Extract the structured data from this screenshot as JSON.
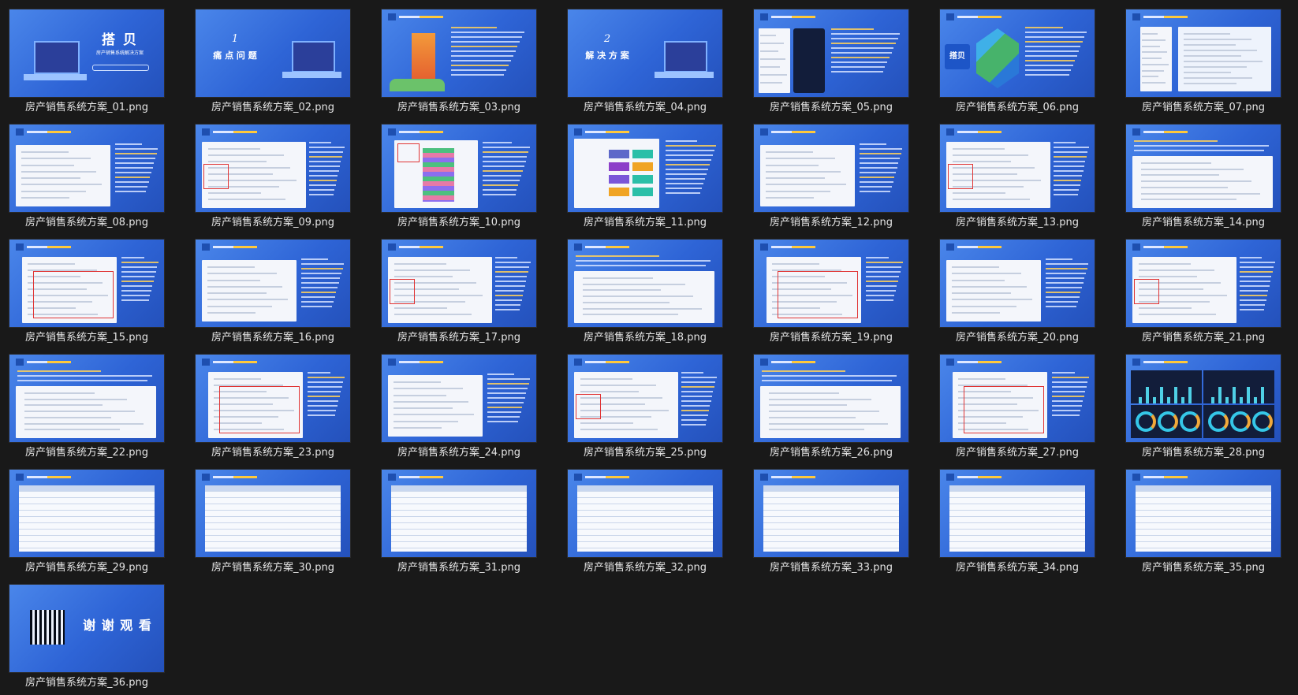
{
  "files": [
    {
      "name": "房产销售系统方案_01.png",
      "kind": "cover",
      "title": "搭 贝",
      "subtitle": "房产销售系统解决方案"
    },
    {
      "name": "房产销售系统方案_02.png",
      "kind": "section",
      "num": "1",
      "title": "痛 点 问 题"
    },
    {
      "name": "房产销售系统方案_03.png",
      "kind": "illus"
    },
    {
      "name": "房产销售系统方案_04.png",
      "kind": "section",
      "num": "2",
      "title": "解 决 方 案"
    },
    {
      "name": "房产销售系统方案_05.png",
      "kind": "phones"
    },
    {
      "name": "房产销售系统方案_06.png",
      "kind": "logo",
      "logo": "搭贝"
    },
    {
      "name": "房产销售系统方案_07.png",
      "kind": "arch"
    },
    {
      "name": "房产销售系统方案_08.png",
      "kind": "screen"
    },
    {
      "name": "房产销售系统方案_09.png",
      "kind": "screen"
    },
    {
      "name": "房产销售系统方案_10.png",
      "kind": "floor"
    },
    {
      "name": "房产销售系统方案_11.png",
      "kind": "floorgrid"
    },
    {
      "name": "房产销售系统方案_12.png",
      "kind": "screen"
    },
    {
      "name": "房产销售系统方案_13.png",
      "kind": "screen"
    },
    {
      "name": "房产销售系统方案_14.png",
      "kind": "screen"
    },
    {
      "name": "房产销售系统方案_15.png",
      "kind": "screen"
    },
    {
      "name": "房产销售系统方案_16.png",
      "kind": "screen"
    },
    {
      "name": "房产销售系统方案_17.png",
      "kind": "screen"
    },
    {
      "name": "房产销售系统方案_18.png",
      "kind": "screen"
    },
    {
      "name": "房产销售系统方案_19.png",
      "kind": "screen"
    },
    {
      "name": "房产销售系统方案_20.png",
      "kind": "screen"
    },
    {
      "name": "房产销售系统方案_21.png",
      "kind": "screen"
    },
    {
      "name": "房产销售系统方案_22.png",
      "kind": "screen"
    },
    {
      "name": "房产销售系统方案_23.png",
      "kind": "screen"
    },
    {
      "name": "房产销售系统方案_24.png",
      "kind": "screen"
    },
    {
      "name": "房产销售系统方案_25.png",
      "kind": "screen"
    },
    {
      "name": "房产销售系统方案_26.png",
      "kind": "screen"
    },
    {
      "name": "房产销售系统方案_27.png",
      "kind": "screen"
    },
    {
      "name": "房产销售系统方案_28.png",
      "kind": "dashboard"
    },
    {
      "name": "房产销售系统方案_29.png",
      "kind": "table"
    },
    {
      "name": "房产销售系统方案_30.png",
      "kind": "table"
    },
    {
      "name": "房产销售系统方案_31.png",
      "kind": "table"
    },
    {
      "name": "房产销售系统方案_32.png",
      "kind": "table"
    },
    {
      "name": "房产销售系统方案_33.png",
      "kind": "table"
    },
    {
      "name": "房产销售系统方案_34.png",
      "kind": "table"
    },
    {
      "name": "房产销售系统方案_35.png",
      "kind": "table"
    },
    {
      "name": "房产销售系统方案_36.png",
      "kind": "thanks",
      "title": "谢 谢 观 看"
    }
  ]
}
